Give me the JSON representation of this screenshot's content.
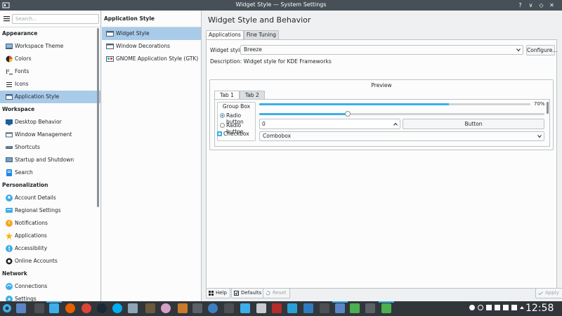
{
  "window": {
    "title": "Widget Style — System Settings",
    "controls": [
      "?",
      "∨",
      "◇",
      "✕"
    ]
  },
  "search": {
    "placeholder": "Search..."
  },
  "sidebar": {
    "categories": [
      {
        "label": "Appearance",
        "items": [
          {
            "label": "Workspace Theme",
            "icon": "workspace-theme-icon"
          },
          {
            "label": "Colors",
            "icon": "colors-icon"
          },
          {
            "label": "Fonts",
            "icon": "fonts-icon"
          },
          {
            "label": "Icons",
            "icon": "icons-icon"
          },
          {
            "label": "Application Style",
            "icon": "application-style-icon",
            "active": true
          }
        ]
      },
      {
        "label": "Workspace",
        "items": [
          {
            "label": "Desktop Behavior",
            "icon": "desktop-behavior-icon"
          },
          {
            "label": "Window Management",
            "icon": "window-management-icon"
          },
          {
            "label": "Shortcuts",
            "icon": "shortcuts-icon"
          },
          {
            "label": "Startup and Shutdown",
            "icon": "startup-shutdown-icon"
          },
          {
            "label": "Search",
            "icon": "search-icon"
          }
        ]
      },
      {
        "label": "Personalization",
        "items": [
          {
            "label": "Account Details",
            "icon": "account-details-icon"
          },
          {
            "label": "Regional Settings",
            "icon": "regional-settings-icon"
          },
          {
            "label": "Notifications",
            "icon": "notifications-icon"
          },
          {
            "label": "Applications",
            "icon": "applications-icon"
          },
          {
            "label": "Accessibility",
            "icon": "accessibility-icon"
          },
          {
            "label": "Online Accounts",
            "icon": "online-accounts-icon"
          }
        ]
      },
      {
        "label": "Network",
        "items": [
          {
            "label": "Connections",
            "icon": "connections-icon"
          },
          {
            "label": "Settings",
            "icon": "network-settings-icon"
          }
        ]
      }
    ]
  },
  "subnav": {
    "header": "Application Style",
    "items": [
      {
        "label": "Widget Style",
        "active": true
      },
      {
        "label": "Window Decorations"
      },
      {
        "label": "GNOME Application Style (GTK)"
      }
    ]
  },
  "main": {
    "title": "Widget Style and Behavior",
    "tabs": [
      "Applications",
      "Fine Tuning"
    ],
    "widget_style_label": "Widget style:",
    "widget_style_value": "Breeze",
    "configure_label": "Configure...",
    "description": "Description: Widget style for KDE Frameworks",
    "preview": {
      "label": "Preview",
      "tabs": [
        "Tab 1",
        "Tab 2"
      ],
      "groupbox_title": "Group Box",
      "radio1": "Radio button",
      "radio2": "Radio button",
      "checkbox": "Checkbox",
      "progress_value": 0.7,
      "progress_text": "70%",
      "slider_value": 0.31,
      "spin_value": "0",
      "button_label": "Button",
      "combobox_label": "Combobox"
    }
  },
  "footer": {
    "help": "Help",
    "defaults": "Defaults",
    "reset": "Reset",
    "apply": "Apply"
  },
  "taskbar": {
    "clock": "12:58"
  },
  "colors": {
    "accent": "#3daee9",
    "selection": "#a9cbea",
    "titlebar": "#475057",
    "taskbar": "#31363b"
  }
}
